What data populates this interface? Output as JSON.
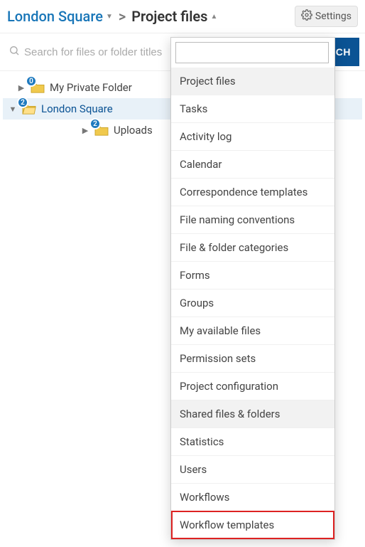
{
  "breadcrumb": {
    "root": "London Square",
    "current": "Project files"
  },
  "settings_label": "Settings",
  "search": {
    "placeholder": "Search for files or folder titles",
    "button": "SEARCH"
  },
  "tree": [
    {
      "label": "My Private Folder",
      "badge": "0",
      "expanded": false,
      "indent": 0,
      "selected": false
    },
    {
      "label": "London Square",
      "badge": "2",
      "expanded": true,
      "indent": 0,
      "selected": true
    },
    {
      "label": "Uploads",
      "badge": "2",
      "expanded": false,
      "indent": 2,
      "selected": false
    }
  ],
  "dropdown": {
    "filter_value": "",
    "items": [
      {
        "label": "Project files",
        "active": true
      },
      {
        "label": "Tasks"
      },
      {
        "label": "Activity log"
      },
      {
        "label": "Calendar"
      },
      {
        "label": "Correspondence templates"
      },
      {
        "label": "File naming conventions"
      },
      {
        "label": "File & folder categories"
      },
      {
        "label": "Forms"
      },
      {
        "label": "Groups"
      },
      {
        "label": "My available files"
      },
      {
        "label": "Permission sets"
      },
      {
        "label": "Project configuration"
      },
      {
        "label": "Shared files & folders",
        "active": true
      },
      {
        "label": "Statistics"
      },
      {
        "label": "Users"
      },
      {
        "label": "Workflows"
      },
      {
        "label": "Workflow templates",
        "highlight": true
      }
    ]
  }
}
